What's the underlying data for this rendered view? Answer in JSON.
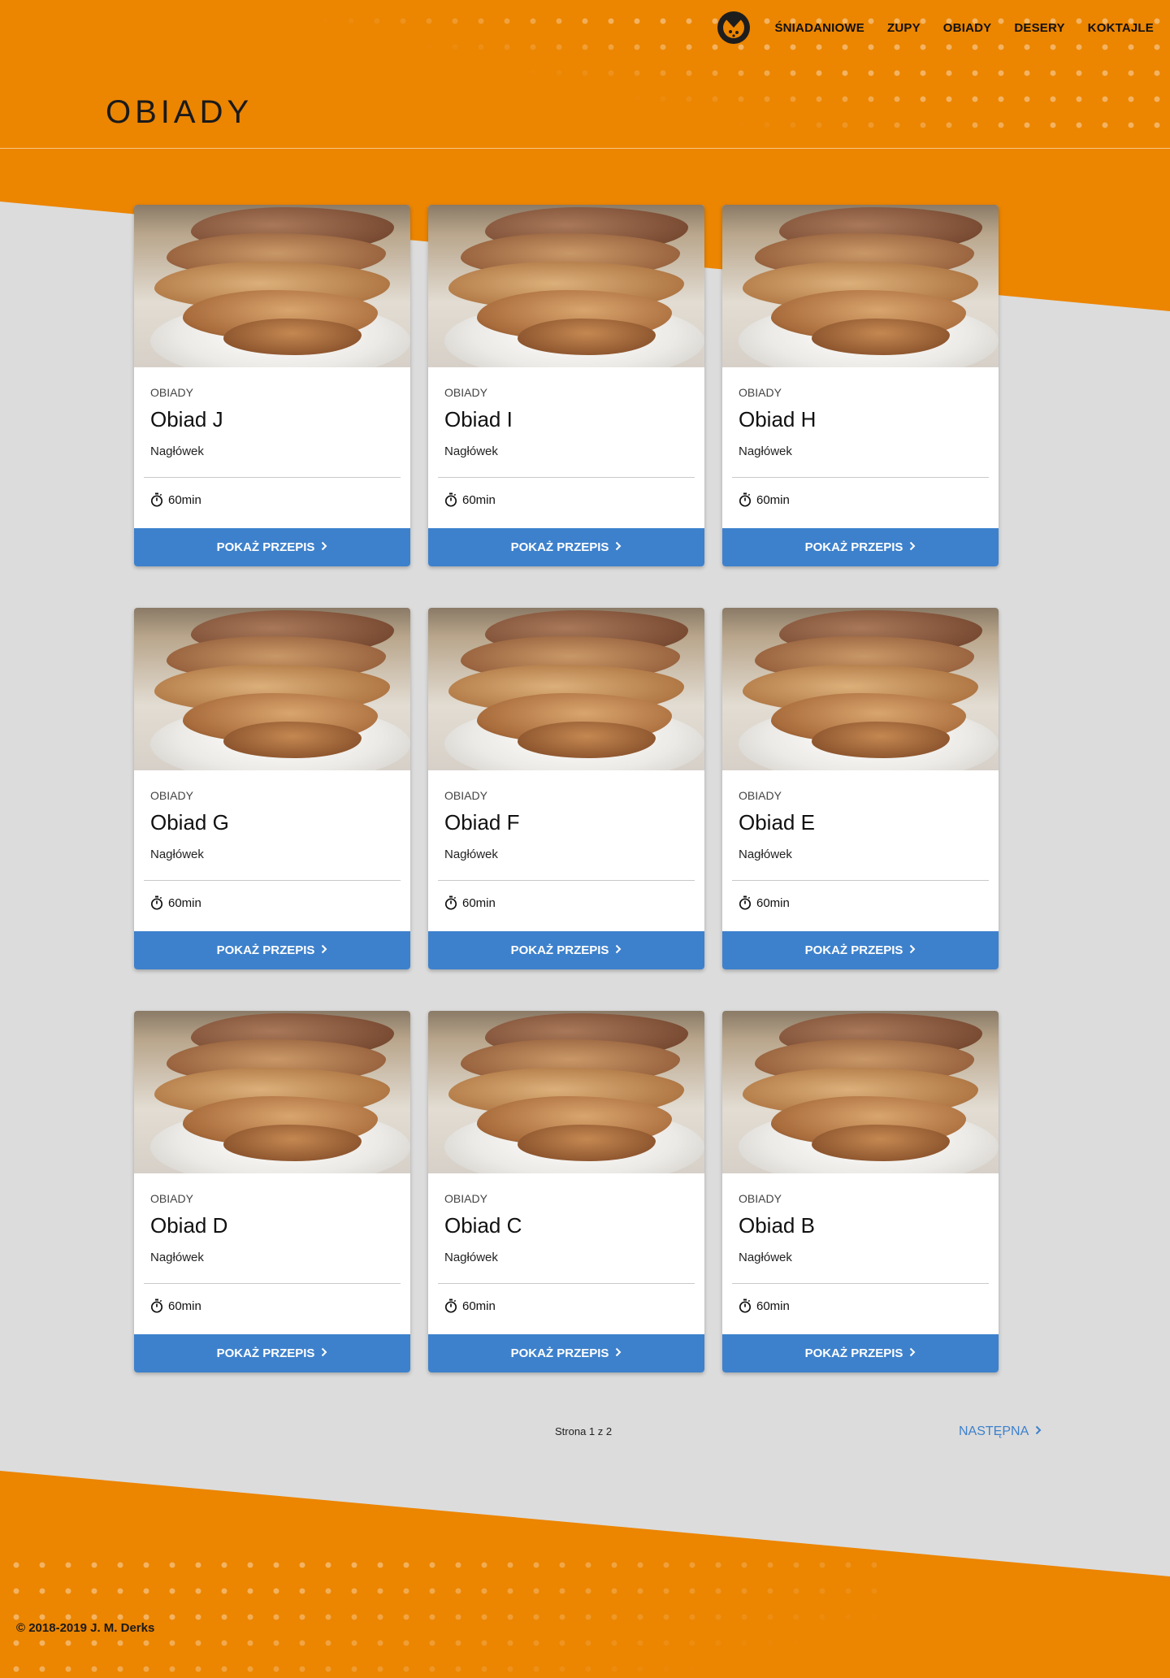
{
  "header": {
    "title": "OBIADY",
    "nav": [
      "ŚNIADANIOWE",
      "ZUPY",
      "OBIADY",
      "DESERY",
      "KOKTAJLE"
    ],
    "logo_icon": "pizza-logo-icon"
  },
  "colors": {
    "accent": "#ec8500",
    "button": "#3d81cc",
    "page_background": "#dcdcdc"
  },
  "recipes": [
    {
      "category": "OBIADY",
      "title": "Obiad J",
      "subtitle": "Nagłówek",
      "time": "60min",
      "button": "POKAŻ PRZEPIS"
    },
    {
      "category": "OBIADY",
      "title": "Obiad I",
      "subtitle": "Nagłówek",
      "time": "60min",
      "button": "POKAŻ PRZEPIS"
    },
    {
      "category": "OBIADY",
      "title": "Obiad H",
      "subtitle": "Nagłówek",
      "time": "60min",
      "button": "POKAŻ PRZEPIS"
    },
    {
      "category": "OBIADY",
      "title": "Obiad G",
      "subtitle": "Nagłówek",
      "time": "60min",
      "button": "POKAŻ PRZEPIS"
    },
    {
      "category": "OBIADY",
      "title": "Obiad F",
      "subtitle": "Nagłówek",
      "time": "60min",
      "button": "POKAŻ PRZEPIS"
    },
    {
      "category": "OBIADY",
      "title": "Obiad E",
      "subtitle": "Nagłówek",
      "time": "60min",
      "button": "POKAŻ PRZEPIS"
    },
    {
      "category": "OBIADY",
      "title": "Obiad D",
      "subtitle": "Nagłówek",
      "time": "60min",
      "button": "POKAŻ PRZEPIS"
    },
    {
      "category": "OBIADY",
      "title": "Obiad C",
      "subtitle": "Nagłówek",
      "time": "60min",
      "button": "POKAŻ PRZEPIS"
    },
    {
      "category": "OBIADY",
      "title": "Obiad B",
      "subtitle": "Nagłówek",
      "time": "60min",
      "button": "POKAŻ PRZEPIS"
    }
  ],
  "pagination": {
    "info": "Strona 1 z 2",
    "next": "NASTĘPNA"
  },
  "footer": {
    "copyright": "© 2018-2019 J. M. Derks"
  }
}
